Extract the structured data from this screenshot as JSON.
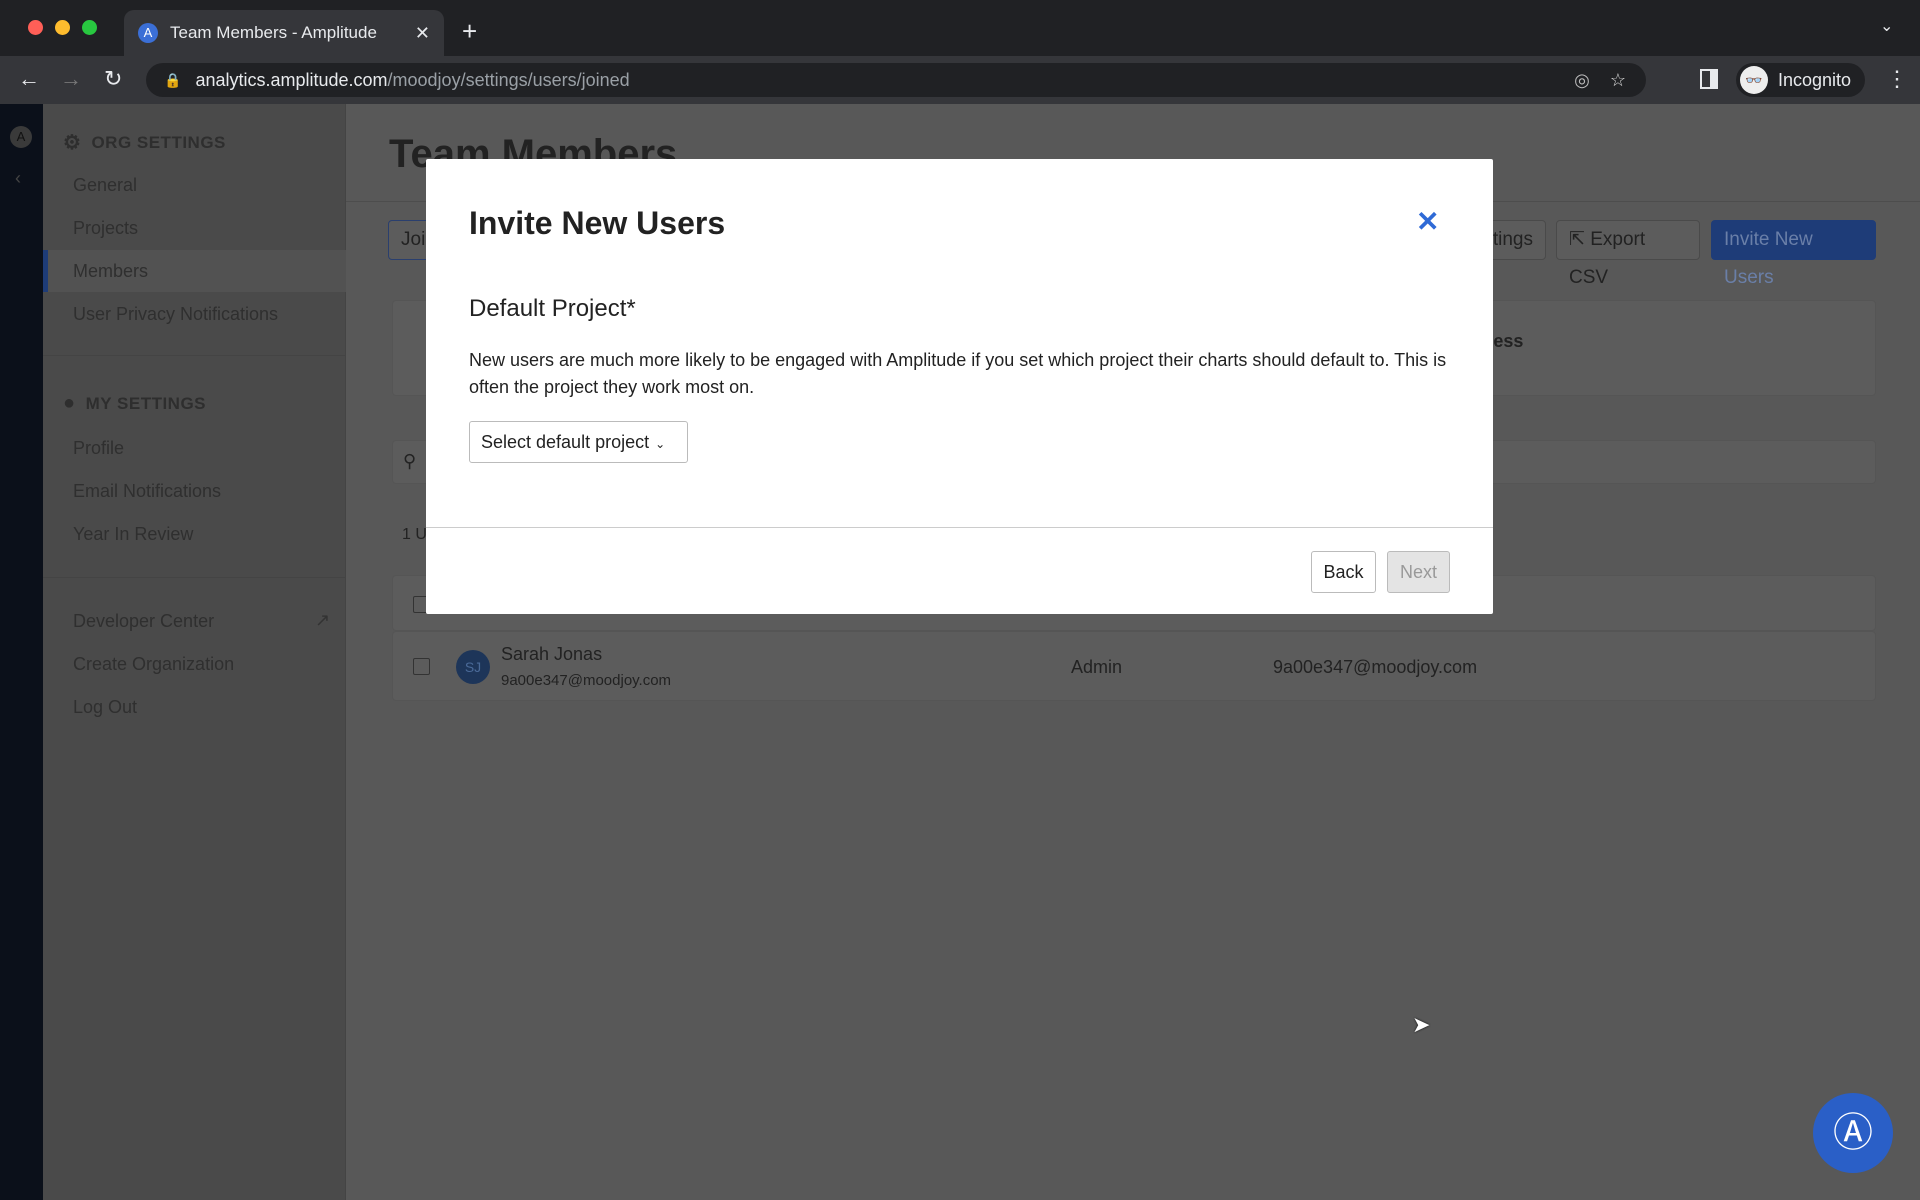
{
  "browser": {
    "tab_title": "Team Members - Amplitude",
    "url_host": "analytics.amplitude.com",
    "url_path": "/moodjoy/settings/users/joined",
    "profile": "Incognito"
  },
  "sidebar": {
    "org_heading": "ORG SETTINGS",
    "org_items": [
      "General",
      "Projects",
      "Members",
      "User Privacy Notifications"
    ],
    "my_heading": "MY SETTINGS",
    "my_items": [
      "Profile",
      "Email Notifications",
      "Year In Review"
    ],
    "other_items": [
      "Developer Center",
      "Create Organization",
      "Log Out"
    ],
    "active": "Members"
  },
  "main": {
    "title": "Team Members",
    "tab_partial": "Joi",
    "settings_partial": "tings",
    "export": "Export CSV",
    "invite": "Invite New Users",
    "card_partial": "sting Access",
    "count_partial": "1 U",
    "rows": [
      {
        "initials": "SJ",
        "name": "Sarah Jonas",
        "email": "9a00e347@moodjoy.com",
        "role": "Admin",
        "email2": "9a00e347@moodjoy.com"
      }
    ]
  },
  "modal": {
    "title": "Invite New Users",
    "section": "Default Project*",
    "description": "New users are much more likely to be engaged with Amplitude if you set which project their charts should default to. This is often the project they work most on.",
    "select_placeholder": "Select default project",
    "back": "Back",
    "next": "Next"
  },
  "colors": {
    "accent": "#2f6ad6",
    "primary_button": "#1e3c78"
  }
}
